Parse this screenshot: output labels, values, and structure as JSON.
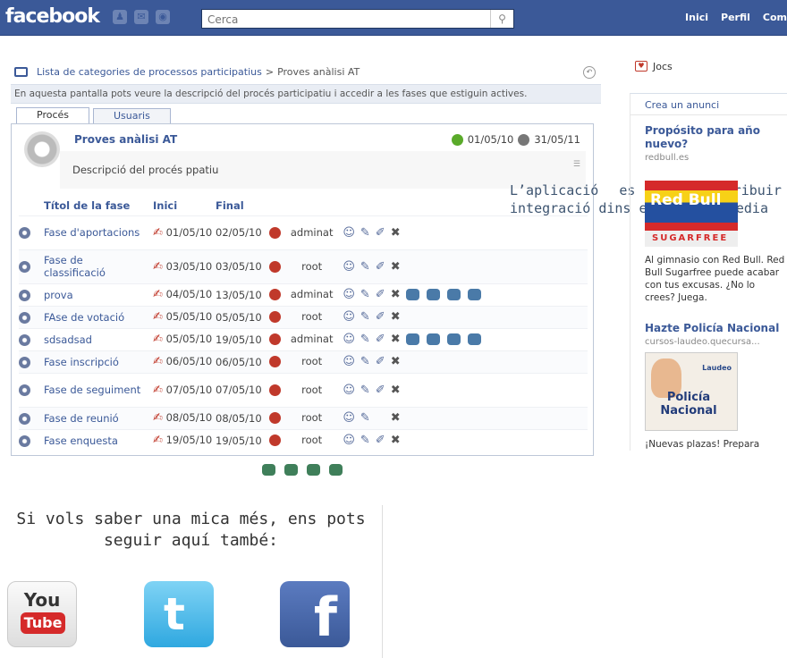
{
  "topbar": {
    "logo": "facebook",
    "search_placeholder": "Cerca",
    "nav": [
      "Inici",
      "Perfil",
      "Com"
    ]
  },
  "app": {
    "breadcrumb": {
      "link": "Lista de categories de processos participatius",
      "separator": ">",
      "current": "Proves anàlisi AT"
    },
    "info": "En aquesta pantalla pots veure la descripció del procés participatiu i accedir a les fases que estiguin actives.",
    "tabs": [
      "Procés",
      "Usuaris"
    ],
    "process": {
      "title": "Proves anàlisi AT",
      "start_date": "01/05/10",
      "end_date": "31/05/11",
      "description": "Descripció del procés ppatiu"
    },
    "table": {
      "headers": [
        "Títol de la fase",
        "Inici",
        "Final"
      ],
      "rows": [
        {
          "name": "Fase d'aportacions",
          "start": "01/05/10",
          "end": "02/05/10",
          "user": "adminat",
          "actions": 4,
          "extra": 0
        },
        {
          "name": "Fase de classificació",
          "start": "03/05/10",
          "end": "03/05/10",
          "user": "root",
          "actions": 4,
          "extra": 0
        },
        {
          "name": "prova",
          "start": "04/05/10",
          "end": "13/05/10",
          "user": "adminat",
          "actions": 4,
          "extra": 4
        },
        {
          "name": "FAse de votació",
          "start": "05/05/10",
          "end": "05/05/10",
          "user": "root",
          "actions": 4,
          "extra": 0
        },
        {
          "name": "sdsadsad",
          "start": "05/05/10",
          "end": "19/05/10",
          "user": "adminat",
          "actions": 4,
          "extra": 4
        },
        {
          "name": "Fase inscripció",
          "start": "06/05/10",
          "end": "06/05/10",
          "user": "root",
          "actions": 4,
          "extra": 0
        },
        {
          "name": "Fase de seguiment",
          "start": "07/05/10",
          "end": "07/05/10",
          "user": "root",
          "actions": 4,
          "extra": 0
        },
        {
          "name": "Fase de reunió",
          "start": "08/05/10",
          "end": "08/05/10",
          "user": "root",
          "actions": 3,
          "extra": 0
        },
        {
          "name": "Fase enquesta",
          "start": "19/05/10",
          "end": "19/05/10",
          "user": "root",
          "actions": 4,
          "extra": 0
        }
      ]
    }
  },
  "sidebar": {
    "games": "Jocs",
    "create_ad": "Crea un anunci",
    "ads": [
      {
        "title": "Propósito para año nuevo?",
        "domain": "redbull.es",
        "image_text": "Red Bull",
        "image_subtext": "SUGARFREE",
        "body": "Al gimnasio con Red Bull. Red Bull Sugarfree puede acabar con tus excusas. ¿No lo crees? Juega."
      },
      {
        "title": "Hazte Policía Nacional",
        "domain": "cursos-laudeo.quecursa...",
        "image_text": "Policía Nacional",
        "image_subtext": "Laudeo",
        "body": "¡Nuevas plazas! Prepara"
      }
    ]
  },
  "caption": {
    "line1": "L’aplicació es pot distribuir",
    "line2": "integració dins els Social Media"
  },
  "follow": {
    "line1": "Si vols saber una mica més, ens pots",
    "line2": "seguir aquí també:",
    "youtube_top": "You",
    "youtube_bottom": "Tube",
    "twitter_letter": "t",
    "facebook_letter": "f"
  },
  "colors": {
    "facebook_blue": "#3b5998",
    "link": "#3b5998",
    "status_red": "#c0392b",
    "status_green": "#5aaa2a"
  }
}
